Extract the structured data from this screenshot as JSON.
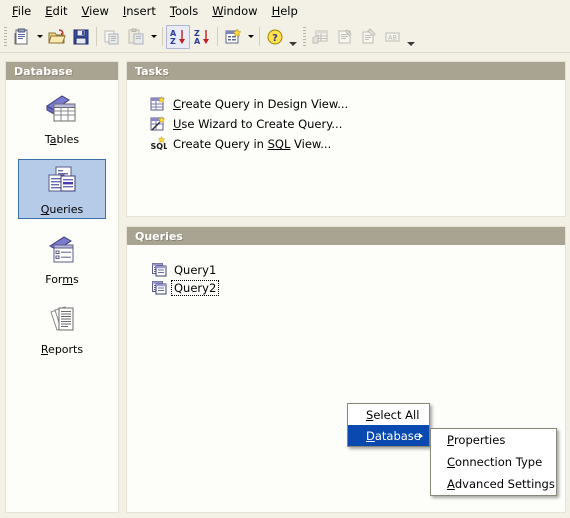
{
  "menubar": {
    "items": [
      {
        "label": "File",
        "mnemonic": "F"
      },
      {
        "label": "Edit",
        "mnemonic": "E"
      },
      {
        "label": "View",
        "mnemonic": "V"
      },
      {
        "label": "Insert",
        "mnemonic": "I"
      },
      {
        "label": "Tools",
        "mnemonic": "T"
      },
      {
        "label": "Window",
        "mnemonic": "W"
      },
      {
        "label": "Help",
        "mnemonic": "H"
      }
    ]
  },
  "toolbar": {
    "buttons": [
      {
        "name": "new-document-icon",
        "title": "New"
      },
      {
        "name": "open-folder-icon",
        "title": "Open"
      },
      {
        "name": "save-floppy-icon",
        "title": "Save"
      },
      {
        "name": "copy-icon",
        "title": "Copy"
      },
      {
        "name": "paste-icon",
        "title": "Paste"
      },
      {
        "name": "sort-ascending-icon",
        "title": "Sort Ascending",
        "state": "active"
      },
      {
        "name": "sort-descending-icon",
        "title": "Sort Descending"
      },
      {
        "name": "form-wizard-icon",
        "title": "Form"
      },
      {
        "name": "help-icon",
        "title": "Help"
      },
      {
        "name": "report-grid-icon",
        "title": "Report",
        "state": "disabled"
      },
      {
        "name": "report-edit-icon",
        "title": "Edit Report",
        "state": "disabled"
      },
      {
        "name": "form-edit-icon",
        "title": "Edit Form",
        "state": "disabled"
      },
      {
        "name": "abc-label-icon",
        "title": "Labels",
        "state": "disabled"
      }
    ]
  },
  "sidebar": {
    "title": "Database",
    "items": [
      {
        "label": "Tables",
        "mnemonic": "a",
        "icon": "tables-icon",
        "selected": false
      },
      {
        "label": "Queries",
        "mnemonic": "Q",
        "icon": "queries-icon",
        "selected": true
      },
      {
        "label": "Forms",
        "mnemonic": "m",
        "icon": "forms-icon",
        "selected": false
      },
      {
        "label": "Reports",
        "mnemonic": "R",
        "icon": "reports-icon",
        "selected": false
      }
    ]
  },
  "tasks": {
    "title": "Tasks",
    "items": [
      {
        "pre": "",
        "mn": "C",
        "post": "reate Query in Design View...",
        "icon": "create-query-design-icon"
      },
      {
        "pre": "",
        "mn": "U",
        "post": "se Wizard to Create Query...",
        "icon": "query-wizard-icon"
      },
      {
        "pre": "Create Query in ",
        "mn": "SQL",
        "post": " View...",
        "icon": "sql-view-icon"
      }
    ]
  },
  "queries": {
    "title": "Queries",
    "items": [
      {
        "label": "Query1",
        "focused": false
      },
      {
        "label": "Query2",
        "focused": true
      }
    ]
  },
  "context_menu": {
    "items": [
      {
        "pre": "",
        "mn": "S",
        "post": "elect All",
        "highlight": false,
        "submenu": false
      },
      {
        "pre": "",
        "mn": "D",
        "post": "atabase",
        "highlight": true,
        "submenu": true
      }
    ],
    "submenu": {
      "items": [
        {
          "pre": "",
          "mn": "P",
          "post": "roperties"
        },
        {
          "pre": "",
          "mn": "C",
          "post": "onnection Type"
        },
        {
          "pre": "",
          "mn": "A",
          "post": "dvanced Settings"
        }
      ]
    }
  },
  "colors": {
    "window_bg": "#f3f1e6",
    "panel_bg": "#fdfdfa",
    "panel_header": "#a9a391",
    "selection_bg": "#b6cbe8",
    "selection_border": "#3c6ea9",
    "menu_highlight": "#0a49b0"
  }
}
